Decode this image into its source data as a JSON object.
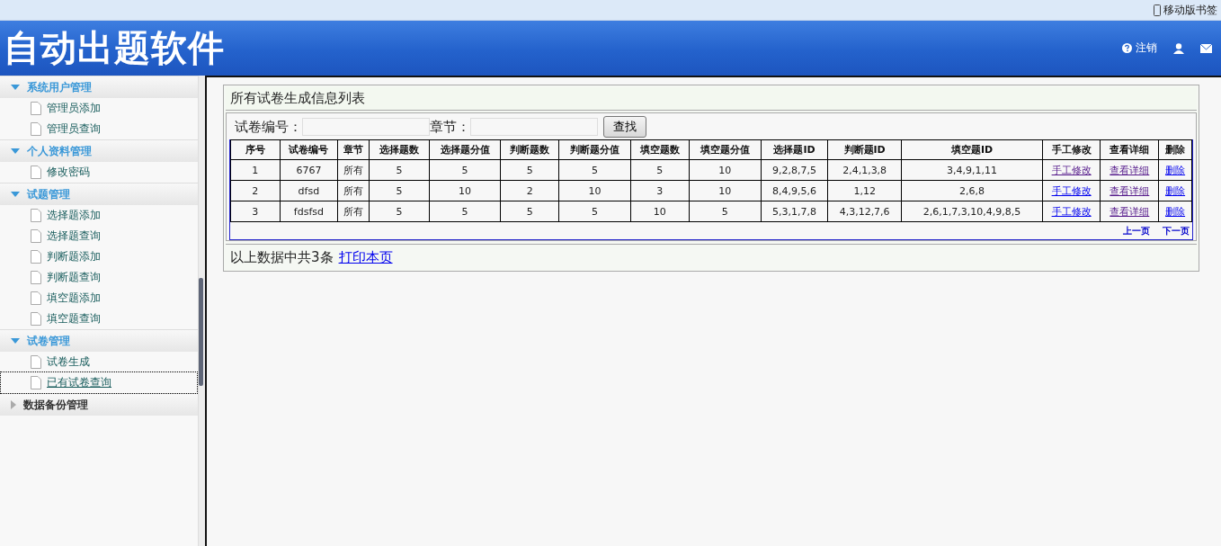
{
  "browser_bar": {
    "bookmark": "移动版书签"
  },
  "header": {
    "title": "自动出题软件",
    "logout": "注销"
  },
  "sidebar": {
    "groups": [
      {
        "title": "系统用户管理",
        "expanded": true,
        "items": [
          {
            "label": "管理员添加",
            "selected": false
          },
          {
            "label": "管理员查询",
            "selected": false
          }
        ]
      },
      {
        "title": "个人资料管理",
        "expanded": true,
        "items": [
          {
            "label": "修改密码",
            "selected": false
          }
        ]
      },
      {
        "title": "试题管理",
        "expanded": true,
        "items": [
          {
            "label": "选择题添加",
            "selected": false
          },
          {
            "label": "选择题查询",
            "selected": false
          },
          {
            "label": "判断题添加",
            "selected": false
          },
          {
            "label": "判断题查询",
            "selected": false
          },
          {
            "label": "填空题添加",
            "selected": false
          },
          {
            "label": "填空题查询",
            "selected": false
          }
        ]
      },
      {
        "title": "试卷管理",
        "expanded": true,
        "items": [
          {
            "label": "试卷生成",
            "selected": false
          },
          {
            "label": "已有试卷查询",
            "selected": true
          }
        ]
      },
      {
        "title": "数据备份管理",
        "expanded": false
      }
    ]
  },
  "panel": {
    "title": "所有试卷生成信息列表",
    "search": {
      "fields": [
        {
          "label": "试卷编号："
        },
        {
          "label": "章节："
        }
      ],
      "button": "查找"
    },
    "table": {
      "columns": [
        "序号",
        "试卷编号",
        "章节",
        "选择题数",
        "选择题分值",
        "判断题数",
        "判断题分值",
        "填空题数",
        "填空题分值",
        "选择题ID",
        "判断题ID",
        "填空题ID",
        "手工修改",
        "查看详细",
        "删除"
      ],
      "rows": [
        {
          "cells": [
            "1",
            "6767",
            "所有",
            "5",
            "5",
            "5",
            "5",
            "5",
            "10",
            "9,2,8,7,5",
            "2,4,1,3,8",
            "3,4,9,1,11"
          ],
          "links": [
            {
              "label": "手工修改",
              "visited": true
            },
            {
              "label": "查看详细",
              "visited": true
            },
            {
              "label": "删除",
              "visited": false
            }
          ]
        },
        {
          "cells": [
            "2",
            "dfsd",
            "所有",
            "5",
            "10",
            "2",
            "10",
            "3",
            "10",
            "8,4,9,5,6",
            "1,12",
            "2,6,8"
          ],
          "links": [
            {
              "label": "手工修改",
              "visited": false
            },
            {
              "label": "查看详细",
              "visited": true
            },
            {
              "label": "删除",
              "visited": false
            }
          ]
        },
        {
          "cells": [
            "3",
            "fdsfsd",
            "所有",
            "5",
            "5",
            "5",
            "5",
            "10",
            "5",
            "5,3,1,7,8",
            "4,3,12,7,6",
            "2,6,1,7,3,10,4,9,8,5"
          ],
          "links": [
            {
              "label": "手工修改",
              "visited": false
            },
            {
              "label": "查看详细",
              "visited": true
            },
            {
              "label": "删除",
              "visited": false
            }
          ]
        }
      ],
      "pager": [
        "上一页",
        "下一页"
      ]
    },
    "footer": {
      "count": "以上数据中共3条",
      "print": "打印本页"
    }
  }
}
